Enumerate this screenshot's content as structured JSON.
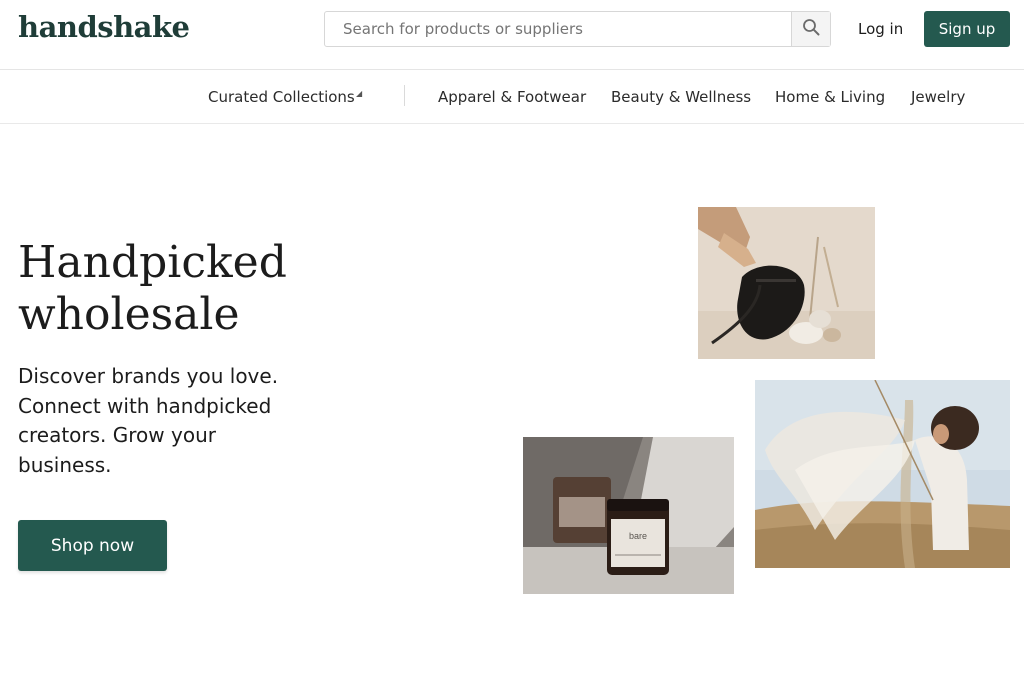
{
  "brand": {
    "logo_text": "handshake"
  },
  "search": {
    "placeholder": "Search for products or suppliers",
    "icon": "search-icon"
  },
  "auth": {
    "login_label": "Log in",
    "signup_label": "Sign up"
  },
  "nav": {
    "items": [
      {
        "label": "Curated Collections"
      },
      {
        "label": "Apparel & Footwear"
      },
      {
        "label": "Beauty & Wellness"
      },
      {
        "label": "Home & Living"
      },
      {
        "label": "Jewelry"
      }
    ],
    "dropdown_icon": "caret-icon"
  },
  "hero": {
    "title": "Handpicked wholesale",
    "subtitle": "Discover brands you love. Connect with handpicked creators. Grow your business.",
    "cta_label": "Shop now"
  },
  "images": {
    "bag_photo": "bag-photo",
    "candle_photo": "candle-photo",
    "candle_label": "bare",
    "fabric_photo": "fabric-photo"
  },
  "colors": {
    "brand_green": "#24594f",
    "logo_green": "#1f3d38"
  }
}
